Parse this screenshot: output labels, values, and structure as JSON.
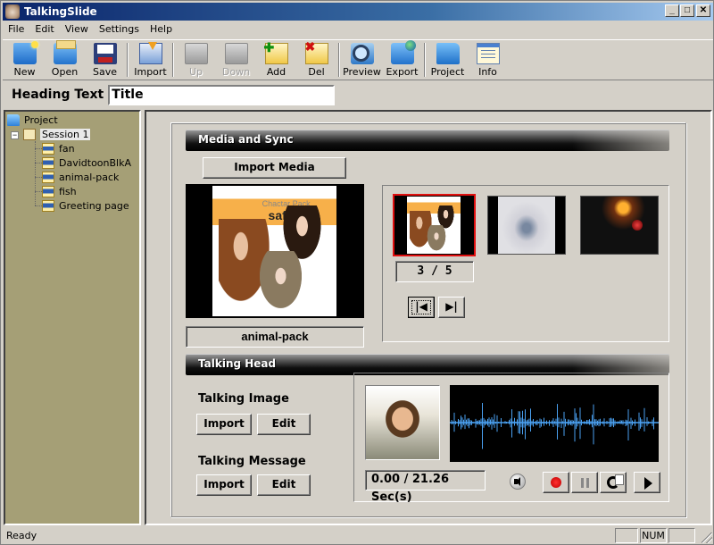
{
  "window": {
    "title": "TalkingSlide",
    "controls": {
      "minimize": "_",
      "maximize": "□",
      "close": "✕"
    }
  },
  "menu": [
    "File",
    "Edit",
    "View",
    "Settings",
    "Help"
  ],
  "toolbar": {
    "new": "New",
    "open": "Open",
    "save": "Save",
    "import": "Import",
    "up": "Up",
    "down": "Down",
    "add": "Add",
    "del": "Del",
    "preview": "Preview",
    "export": "Export",
    "project": "Project",
    "info": "Info"
  },
  "heading": {
    "label": "Heading Text",
    "value": "Title"
  },
  "tree": {
    "root": "Project",
    "session": "Session 1",
    "expander": "−",
    "slides": [
      "fan",
      "DavidtoonBlkA",
      "animal-pack",
      "fish",
      "Greeting page"
    ]
  },
  "media_sync": {
    "title": "Media and Sync",
    "import_button": "Import Media",
    "preview_caption": "animal-pack",
    "preview_text_small": "Chactar Pack",
    "preview_text_big": "safari",
    "counter": "3 / 5",
    "thumbnails": [
      {
        "name": "animal-pack",
        "selected": true
      },
      {
        "name": "fish",
        "selected": false
      },
      {
        "name": "Greeting page",
        "selected": false
      }
    ],
    "nav": {
      "first": "|◀",
      "last": "▶|"
    }
  },
  "talking_head": {
    "title": "Talking Head",
    "image_label": "Talking Image",
    "message_label": "Talking Message",
    "import": "Import",
    "edit": "Edit",
    "time": "0.00 / 21.26 Sec(s)",
    "waveform_color": "#4aa0f0"
  },
  "status": {
    "text": "Ready",
    "num": "NUM"
  }
}
